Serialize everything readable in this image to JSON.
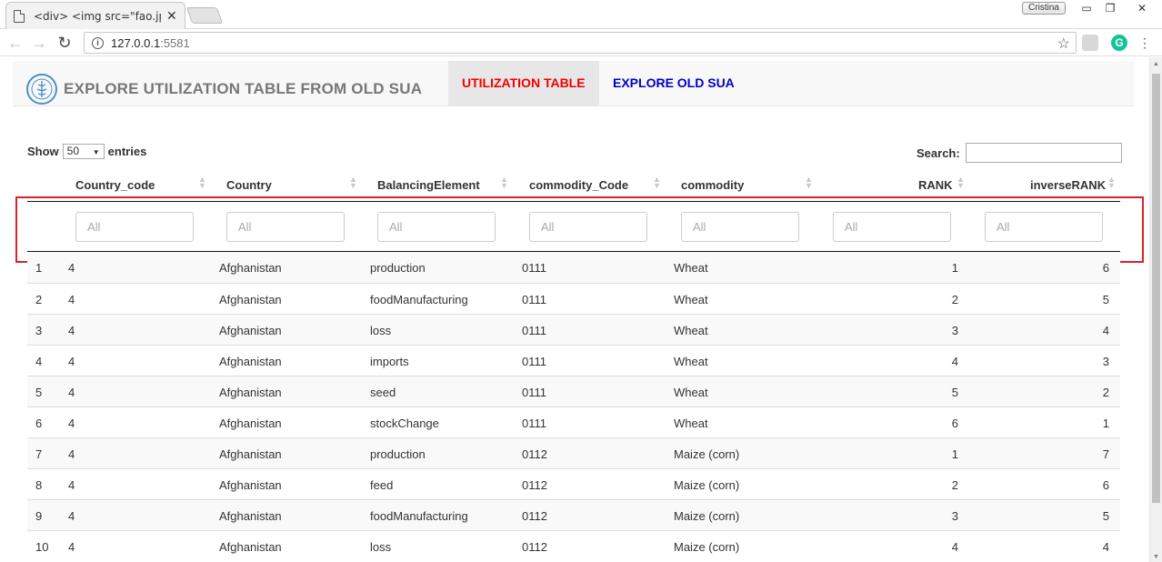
{
  "browser": {
    "tab_title": "<div> <img src=\"fao.jpg",
    "tab_close": "✕",
    "user": "Cristina",
    "url_host": "127.0.0.1",
    "url_port": ":5581"
  },
  "navbar": {
    "brand": "EXPLORE UTILIZATION TABLE FROM OLD SUA",
    "tabs": [
      {
        "label": "UTILIZATION TABLE"
      },
      {
        "label": "EXPLORE OLD SUA"
      }
    ]
  },
  "controls": {
    "show_label": "Show",
    "entries_value": "50",
    "entries_label": "entries",
    "search_label": "Search:"
  },
  "table": {
    "columns": [
      "Country_code",
      "Country",
      "BalancingElement",
      "commodity_Code",
      "commodity",
      "RANK",
      "inverseRANK"
    ],
    "filter_placeholder": "All",
    "rows": [
      [
        "1",
        "4",
        "Afghanistan",
        "production",
        "0111",
        "Wheat",
        "1",
        "6"
      ],
      [
        "2",
        "4",
        "Afghanistan",
        "foodManufacturing",
        "0111",
        "Wheat",
        "2",
        "5"
      ],
      [
        "3",
        "4",
        "Afghanistan",
        "loss",
        "0111",
        "Wheat",
        "3",
        "4"
      ],
      [
        "4",
        "4",
        "Afghanistan",
        "imports",
        "0111",
        "Wheat",
        "4",
        "3"
      ],
      [
        "5",
        "4",
        "Afghanistan",
        "seed",
        "0111",
        "Wheat",
        "5",
        "2"
      ],
      [
        "6",
        "4",
        "Afghanistan",
        "stockChange",
        "0111",
        "Wheat",
        "6",
        "1"
      ],
      [
        "7",
        "4",
        "Afghanistan",
        "production",
        "0112",
        "Maize (corn)",
        "1",
        "7"
      ],
      [
        "8",
        "4",
        "Afghanistan",
        "feed",
        "0112",
        "Maize (corn)",
        "2",
        "6"
      ],
      [
        "9",
        "4",
        "Afghanistan",
        "foodManufacturing",
        "0112",
        "Maize (corn)",
        "3",
        "5"
      ],
      [
        "10",
        "4",
        "Afghanistan",
        "loss",
        "0112",
        "Maize (corn)",
        "4",
        "4"
      ]
    ]
  },
  "colors": {
    "active_tab": "#e00000",
    "other_tab": "#0000cc",
    "highlight_box": "#d9232b"
  }
}
